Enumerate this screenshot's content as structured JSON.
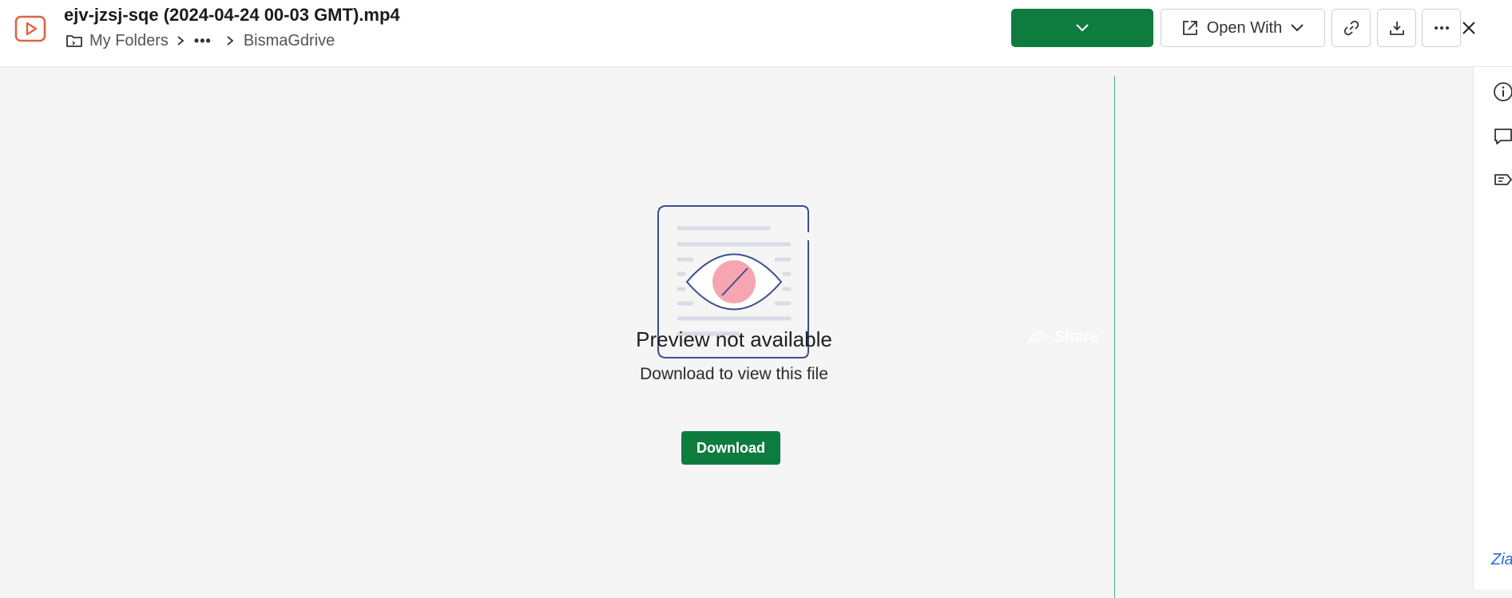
{
  "header": {
    "file_title": "ejv-jzsj-sqe (2024-04-24 00-03 GMT).mp4",
    "breadcrumb": {
      "root": "My Folders",
      "ellipsis": "•••",
      "current": "BismaGdrive"
    },
    "share_label": "Share",
    "open_with_label": "Open With"
  },
  "main": {
    "preview_title": "Preview not available",
    "preview_subtitle": "Download to view this file",
    "download_label": "Download"
  },
  "rail": {
    "zia_label": "Zia"
  },
  "colors": {
    "accent_green": "#0f7c3f",
    "video_icon": "#e0643f",
    "illustration_stroke": "#3d4f8c",
    "illustration_pink": "#f7a6b1"
  }
}
